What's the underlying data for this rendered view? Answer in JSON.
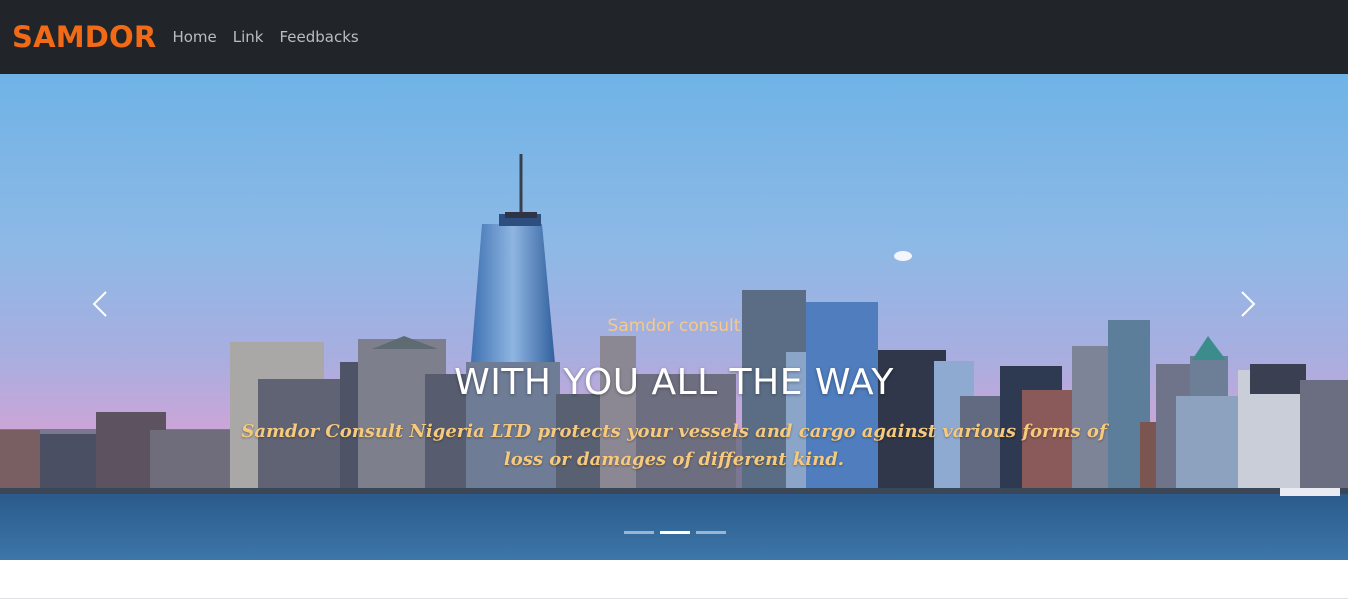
{
  "navbar": {
    "brand": "SAMDOR",
    "links": [
      {
        "label": "Home"
      },
      {
        "label": "Link"
      },
      {
        "label": "Feedbacks"
      }
    ],
    "colors": {
      "background": "#212529",
      "brand": "#f26a16",
      "link": "#b9bcc0"
    }
  },
  "carousel": {
    "background_image": "city-skyline-at-dusk",
    "caption": {
      "subtitle": "Samdor consult",
      "title": "WITH YOU ALL THE WAY",
      "description": "Samdor Consult Nigeria LTD protects your vessels and cargo against various forms of loss or damages of different kind."
    },
    "controls": {
      "prev_icon": "chevron-left-icon",
      "next_icon": "chevron-right-icon"
    },
    "slide_count": 3,
    "active_slide": 2
  }
}
